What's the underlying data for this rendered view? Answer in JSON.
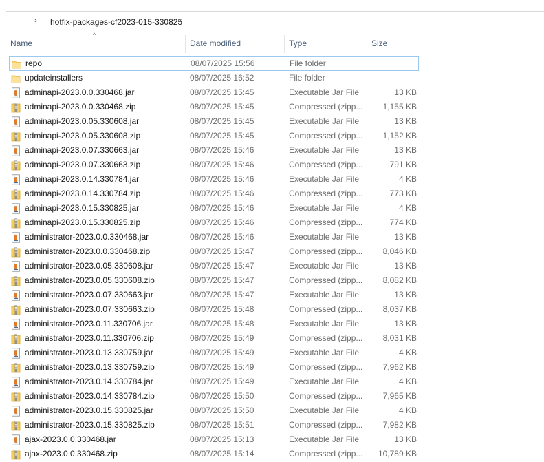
{
  "address_bar": {
    "path_segment": "hotfix-packages-cf2023-015-330825"
  },
  "columns": {
    "name": "Name",
    "date_modified": "Date modified",
    "type": "Type",
    "size": "Size"
  },
  "files": [
    {
      "name": "repo",
      "date": "08/07/2025 15:56",
      "type": "File folder",
      "size": "",
      "icon": "folder-icon"
    },
    {
      "name": "updateinstallers",
      "date": "08/07/2025 16:52",
      "type": "File folder",
      "size": "",
      "icon": "folder-icon"
    },
    {
      "name": "adminapi-2023.0.0.330468.jar",
      "date": "08/07/2025 15:45",
      "type": "Executable Jar File",
      "size": "13 KB",
      "icon": "jar-file-icon"
    },
    {
      "name": "adminapi-2023.0.0.330468.zip",
      "date": "08/07/2025 15:45",
      "type": "Compressed (zipp...",
      "size": "1,155 KB",
      "icon": "zip-file-icon"
    },
    {
      "name": "adminapi-2023.0.05.330608.jar",
      "date": "08/07/2025 15:45",
      "type": "Executable Jar File",
      "size": "13 KB",
      "icon": "jar-file-icon"
    },
    {
      "name": "adminapi-2023.0.05.330608.zip",
      "date": "08/07/2025 15:45",
      "type": "Compressed (zipp...",
      "size": "1,152 KB",
      "icon": "zip-file-icon"
    },
    {
      "name": "adminapi-2023.0.07.330663.jar",
      "date": "08/07/2025 15:46",
      "type": "Executable Jar File",
      "size": "13 KB",
      "icon": "jar-file-icon"
    },
    {
      "name": "adminapi-2023.0.07.330663.zip",
      "date": "08/07/2025 15:46",
      "type": "Compressed (zipp...",
      "size": "791 KB",
      "icon": "zip-file-icon"
    },
    {
      "name": "adminapi-2023.0.14.330784.jar",
      "date": "08/07/2025 15:46",
      "type": "Executable Jar File",
      "size": "4 KB",
      "icon": "jar-file-icon"
    },
    {
      "name": "adminapi-2023.0.14.330784.zip",
      "date": "08/07/2025 15:46",
      "type": "Compressed (zipp...",
      "size": "773 KB",
      "icon": "zip-file-icon"
    },
    {
      "name": "adminapi-2023.0.15.330825.jar",
      "date": "08/07/2025 15:46",
      "type": "Executable Jar File",
      "size": "4 KB",
      "icon": "jar-file-icon"
    },
    {
      "name": "adminapi-2023.0.15.330825.zip",
      "date": "08/07/2025 15:46",
      "type": "Compressed (zipp...",
      "size": "774 KB",
      "icon": "zip-file-icon"
    },
    {
      "name": "administrator-2023.0.0.330468.jar",
      "date": "08/07/2025 15:46",
      "type": "Executable Jar File",
      "size": "13 KB",
      "icon": "jar-file-icon"
    },
    {
      "name": "administrator-2023.0.0.330468.zip",
      "date": "08/07/2025 15:47",
      "type": "Compressed (zipp...",
      "size": "8,046 KB",
      "icon": "zip-file-icon"
    },
    {
      "name": "administrator-2023.0.05.330608.jar",
      "date": "08/07/2025 15:47",
      "type": "Executable Jar File",
      "size": "13 KB",
      "icon": "jar-file-icon"
    },
    {
      "name": "administrator-2023.0.05.330608.zip",
      "date": "08/07/2025 15:47",
      "type": "Compressed (zipp...",
      "size": "8,082 KB",
      "icon": "zip-file-icon"
    },
    {
      "name": "administrator-2023.0.07.330663.jar",
      "date": "08/07/2025 15:47",
      "type": "Executable Jar File",
      "size": "13 KB",
      "icon": "jar-file-icon"
    },
    {
      "name": "administrator-2023.0.07.330663.zip",
      "date": "08/07/2025 15:48",
      "type": "Compressed (zipp...",
      "size": "8,037 KB",
      "icon": "zip-file-icon"
    },
    {
      "name": "administrator-2023.0.11.330706.jar",
      "date": "08/07/2025 15:48",
      "type": "Executable Jar File",
      "size": "13 KB",
      "icon": "jar-file-icon"
    },
    {
      "name": "administrator-2023.0.11.330706.zip",
      "date": "08/07/2025 15:49",
      "type": "Compressed (zipp...",
      "size": "8,031 KB",
      "icon": "zip-file-icon"
    },
    {
      "name": "administrator-2023.0.13.330759.jar",
      "date": "08/07/2025 15:49",
      "type": "Executable Jar File",
      "size": "4 KB",
      "icon": "jar-file-icon"
    },
    {
      "name": "administrator-2023.0.13.330759.zip",
      "date": "08/07/2025 15:49",
      "type": "Compressed (zipp...",
      "size": "7,962 KB",
      "icon": "zip-file-icon"
    },
    {
      "name": "administrator-2023.0.14.330784.jar",
      "date": "08/07/2025 15:49",
      "type": "Executable Jar File",
      "size": "4 KB",
      "icon": "jar-file-icon"
    },
    {
      "name": "administrator-2023.0.14.330784.zip",
      "date": "08/07/2025 15:50",
      "type": "Compressed (zipp...",
      "size": "7,965 KB",
      "icon": "zip-file-icon"
    },
    {
      "name": "administrator-2023.0.15.330825.jar",
      "date": "08/07/2025 15:50",
      "type": "Executable Jar File",
      "size": "4 KB",
      "icon": "jar-file-icon"
    },
    {
      "name": "administrator-2023.0.15.330825.zip",
      "date": "08/07/2025 15:51",
      "type": "Compressed (zipp...",
      "size": "7,982 KB",
      "icon": "zip-file-icon"
    },
    {
      "name": "ajax-2023.0.0.330468.jar",
      "date": "08/07/2025 15:13",
      "type": "Executable Jar File",
      "size": "13 KB",
      "icon": "jar-file-icon"
    },
    {
      "name": "ajax-2023.0.0.330468.zip",
      "date": "08/07/2025 15:14",
      "type": "Compressed (zipp...",
      "size": "10,789 KB",
      "icon": "zip-file-icon"
    }
  ],
  "colors": {
    "header_text": "#4c607a",
    "secondary_text": "#6d6d6d",
    "focus_outline": "#99c9ef",
    "folder": "#f8d775"
  }
}
